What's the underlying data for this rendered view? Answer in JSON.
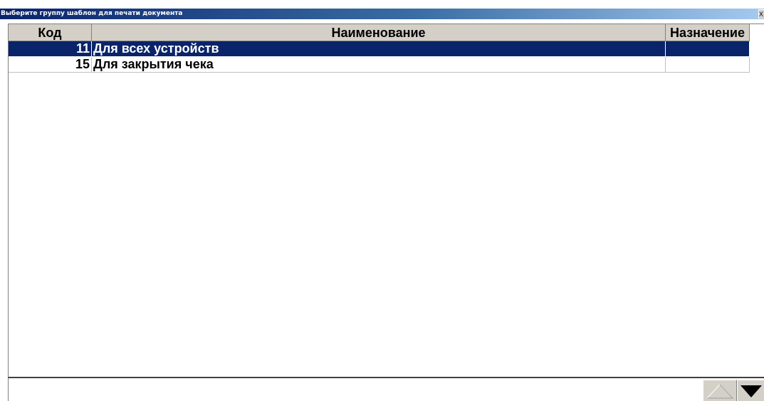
{
  "window": {
    "title": "Выберите группу шаблон для печати документа",
    "close_label": "X"
  },
  "grid": {
    "columns": [
      {
        "key": "code",
        "label": "Код"
      },
      {
        "key": "name",
        "label": "Наименование"
      },
      {
        "key": "purpose",
        "label": "Назначение"
      }
    ],
    "rows": [
      {
        "code": "11",
        "name": "Для всех устройств",
        "purpose": "",
        "selected": true
      },
      {
        "code": "15",
        "name": "Для закрытия чека",
        "purpose": "",
        "selected": false
      }
    ]
  },
  "colors": {
    "selection": "#0a246a",
    "header_bg": "#d4d0c8"
  },
  "icons": {
    "scroll_up": "triangle-up-icon",
    "scroll_down": "triangle-down-icon"
  }
}
